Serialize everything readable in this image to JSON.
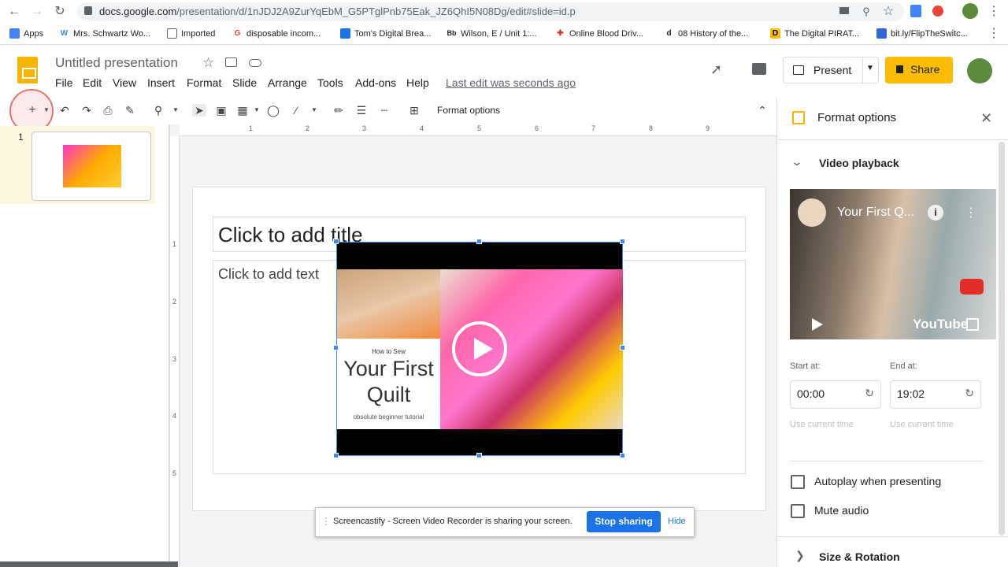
{
  "browser": {
    "url_host": "docs.google.com",
    "url_path": "/presentation/d/1nJDJ2A9ZurYqEbM_G5PTglPnb75Eak_JZ6QhI5N08Dg/edit#slide=id.p",
    "bookmarks": [
      {
        "label": "Apps",
        "color": "#4285f4"
      },
      {
        "label": "Mrs. Schwartz Wo...",
        "color": "#4285f4"
      },
      {
        "label": "Imported",
        "color": "#5f6368"
      },
      {
        "label": "disposable incom...",
        "color": "#ea4335"
      },
      {
        "label": "Tom's Digital Brea...",
        "color": "#1a73e8"
      },
      {
        "label": "Wilson, E / Unit 1:...",
        "color": "#202124"
      },
      {
        "label": "Online Blood Driv...",
        "color": "#d93025"
      },
      {
        "label": "08 History of the...",
        "color": "#202124"
      },
      {
        "label": "The Digital PIRAT...",
        "color": "#000000"
      },
      {
        "label": "bit.ly/FlipTheSwitc...",
        "color": "#3367d6"
      }
    ]
  },
  "doc": {
    "title": "Untitled presentation",
    "menus": [
      "File",
      "Edit",
      "View",
      "Insert",
      "Format",
      "Slide",
      "Arrange",
      "Tools",
      "Add-ons",
      "Help"
    ],
    "last_edit": "Last edit was seconds ago",
    "present_label": "Present",
    "share_label": "Share"
  },
  "toolbar": {
    "format_options": "Format options"
  },
  "slides": {
    "number": "1"
  },
  "ruler": {
    "h": [
      "1",
      "2",
      "3",
      "4",
      "5",
      "6",
      "7",
      "8",
      "9"
    ],
    "v": [
      "1",
      "2",
      "3",
      "4",
      "5"
    ]
  },
  "slide": {
    "title_placeholder": "Click to add title",
    "body_placeholder": "Click to add text",
    "video": {
      "how_to": "How to Sew",
      "title_line1": "Your First",
      "title_line2": "Quilt",
      "subtitle": "obsolute beginner tutorial"
    }
  },
  "panel": {
    "title": "Format options",
    "section_video": "Video playback",
    "preview_title": "Your First Q...",
    "youtube": "YouTube",
    "start_label": "Start at:",
    "end_label": "End at:",
    "start_value": "00:00",
    "end_value": "19:02",
    "hint": "Use current time",
    "autoplay": "Autoplay when presenting",
    "mute": "Mute audio",
    "section_size": "Size & Rotation"
  },
  "sharebar": {
    "message": "Screencastify - Screen Video Recorder is sharing your screen.",
    "stop": "Stop sharing",
    "hide": "Hide"
  }
}
